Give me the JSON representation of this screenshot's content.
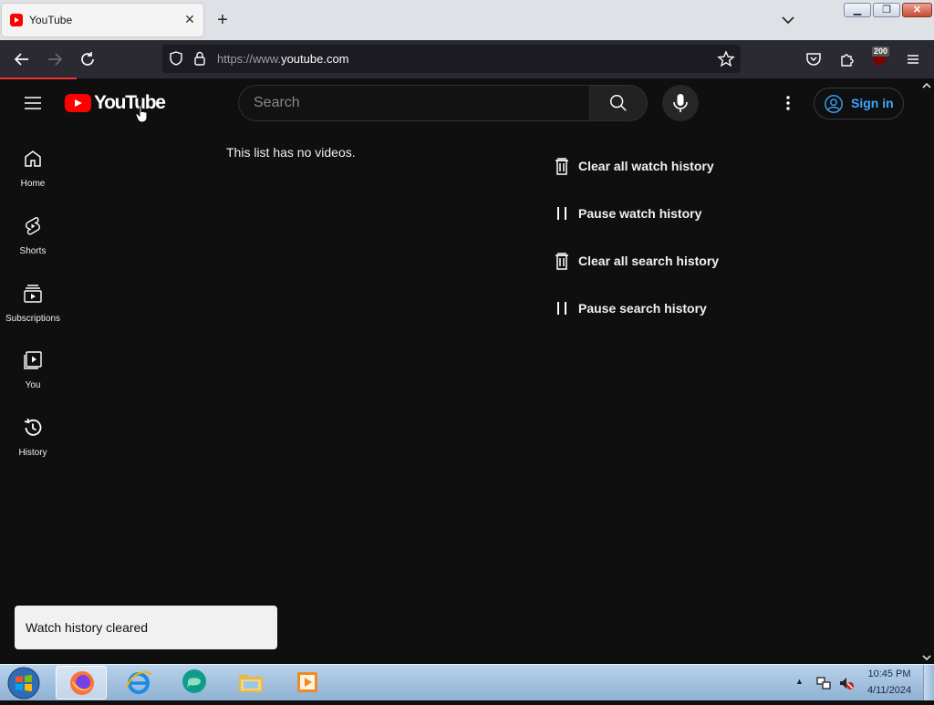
{
  "browser": {
    "tab_title": "YouTube",
    "tab_close": "✕",
    "new_tab": "+",
    "url_prefix": "https://www.",
    "url_host": "youtube.com",
    "ublock_count": "200"
  },
  "youtube": {
    "logo_text": "YouTube",
    "search_placeholder": "Search",
    "signin_label": "Sign in"
  },
  "sidebar": {
    "items": [
      {
        "label": "Home",
        "icon": "home-icon"
      },
      {
        "label": "Shorts",
        "icon": "shorts-icon"
      },
      {
        "label": "Subscriptions",
        "icon": "subscriptions-icon"
      },
      {
        "label": "You",
        "icon": "you-icon"
      },
      {
        "label": "History",
        "icon": "history-icon"
      }
    ]
  },
  "main": {
    "empty_message": "This list has no videos.",
    "actions": [
      {
        "label": "Clear all watch history",
        "icon": "trash-icon"
      },
      {
        "label": "Pause watch history",
        "icon": "pause-icon"
      },
      {
        "label": "Clear all search history",
        "icon": "trash-icon"
      },
      {
        "label": "Pause search history",
        "icon": "pause-icon"
      }
    ]
  },
  "toast": {
    "message": "Watch history cleared"
  },
  "taskbar": {
    "time": "10:45 PM",
    "date": "4/11/2024"
  },
  "colors": {
    "page_bg": "#0f0f0f",
    "brand_red": "#ff0000",
    "link_blue": "#3ea6ff",
    "toolbar_bg": "#2b2a33"
  }
}
